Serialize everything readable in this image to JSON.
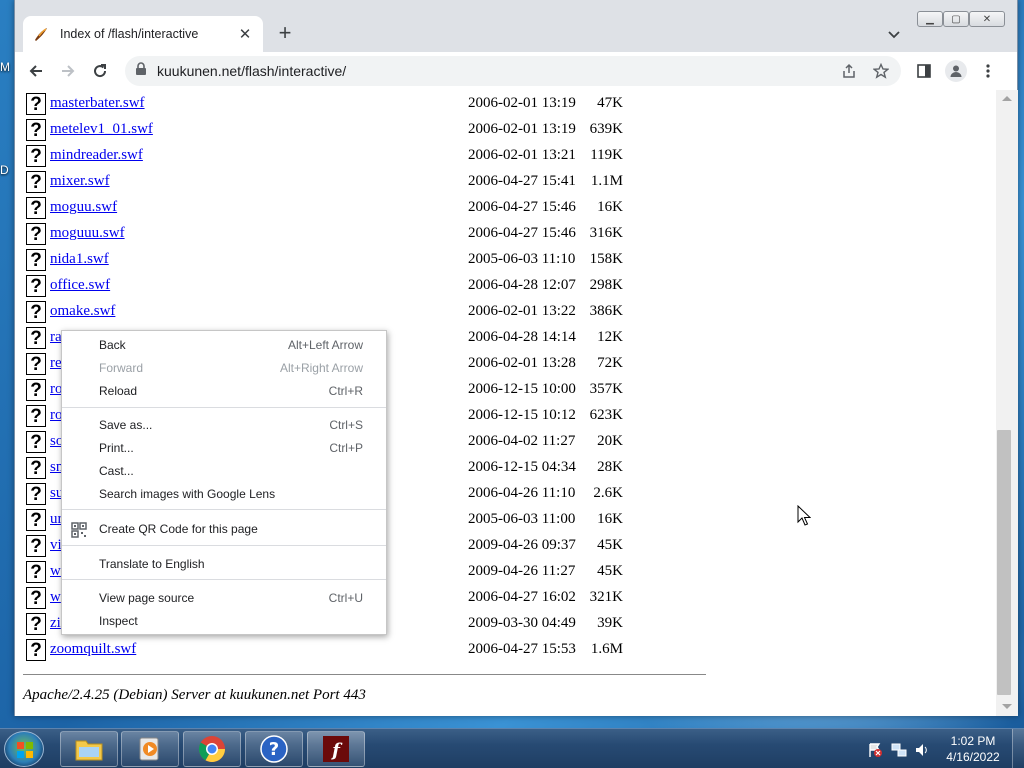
{
  "desktop": {
    "edge_labels": [
      "M",
      "D"
    ]
  },
  "browser": {
    "tab": {
      "title": "Index of /flash/interactive",
      "favicon": "apache-feather-icon"
    },
    "url": "kuukunen.net/flash/interactive/",
    "window_controls": [
      "minimize",
      "maximize",
      "close"
    ]
  },
  "listing": {
    "rows": [
      {
        "name": "masterbater.swf",
        "date": "2006-02-01 13:19",
        "size": "47K"
      },
      {
        "name": "metelev1_01.swf",
        "date": "2006-02-01 13:19",
        "size": "639K"
      },
      {
        "name": "mindreader.swf",
        "date": "2006-02-01 13:21",
        "size": "119K"
      },
      {
        "name": "mixer.swf",
        "date": "2006-04-27 15:41",
        "size": "1.1M"
      },
      {
        "name": "moguu.swf",
        "date": "2006-04-27 15:46",
        "size": "16K"
      },
      {
        "name": "moguuu.swf",
        "date": "2006-04-27 15:46",
        "size": "316K"
      },
      {
        "name": "nida1.swf",
        "date": "2005-06-03 11:10",
        "size": "158K"
      },
      {
        "name": "office.swf",
        "date": "2006-04-28 12:07",
        "size": "298K"
      },
      {
        "name": "omake.swf",
        "date": "2006-02-01 13:22",
        "size": "386K"
      },
      {
        "name": "ra",
        "date": "2006-04-28 14:14",
        "size": "12K"
      },
      {
        "name": "re",
        "date": "2006-02-01 13:28",
        "size": "72K"
      },
      {
        "name": "ro",
        "date": "2006-12-15 10:00",
        "size": "357K"
      },
      {
        "name": "ro",
        "date": "2006-12-15 10:12",
        "size": "623K"
      },
      {
        "name": "so",
        "date": "2006-04-02 11:27",
        "size": "20K"
      },
      {
        "name": "sn",
        "date": "2006-12-15 04:34",
        "size": "28K"
      },
      {
        "name": "su",
        "date": "2006-04-26 11:10",
        "size": "2.6K"
      },
      {
        "name": "ur",
        "date": "2005-06-03 11:00",
        "size": "16K"
      },
      {
        "name": "vi",
        "date": "2009-04-26 09:37",
        "size": "45K"
      },
      {
        "name": "w",
        "date": "2009-04-26 11:27",
        "size": "45K"
      },
      {
        "name": "w",
        "date": "2006-04-27 16:02",
        "size": "321K"
      },
      {
        "name": "zi",
        "date": "2009-03-30 04:49",
        "size": "39K"
      },
      {
        "name": "zoomquilt.swf",
        "date": "2006-04-27 15:53",
        "size": "1.6M"
      }
    ],
    "footer": "Apache/2.4.25 (Debian) Server at kuukunen.net Port 443"
  },
  "context_menu": {
    "items": [
      {
        "label": "Back",
        "shortcut": "Alt+Left Arrow",
        "disabled": false
      },
      {
        "label": "Forward",
        "shortcut": "Alt+Right Arrow",
        "disabled": true
      },
      {
        "label": "Reload",
        "shortcut": "Ctrl+R",
        "disabled": false
      },
      {
        "label": "Save as...",
        "shortcut": "Ctrl+S",
        "disabled": false
      },
      {
        "label": "Print...",
        "shortcut": "Ctrl+P",
        "disabled": false
      },
      {
        "label": "Cast...",
        "shortcut": "",
        "disabled": false
      },
      {
        "label": "Search images with Google Lens",
        "shortcut": "",
        "disabled": false
      },
      {
        "label": "Create QR Code for this page",
        "shortcut": "",
        "disabled": false,
        "icon": "qr-code-icon"
      },
      {
        "label": "Translate to English",
        "shortcut": "",
        "disabled": false
      },
      {
        "label": "View page source",
        "shortcut": "Ctrl+U",
        "disabled": false
      },
      {
        "label": "Inspect",
        "shortcut": "",
        "disabled": false
      }
    ]
  },
  "taskbar": {
    "apps": [
      "explorer-icon",
      "media-player-icon",
      "chrome-icon",
      "help-icon",
      "flash-icon"
    ],
    "clock": {
      "time": "1:02 PM",
      "date": "4/16/2022"
    }
  },
  "colors": {
    "link": "#0000ee",
    "menu_disabled": "#9aa0a6",
    "taskbar": "#274a73"
  }
}
